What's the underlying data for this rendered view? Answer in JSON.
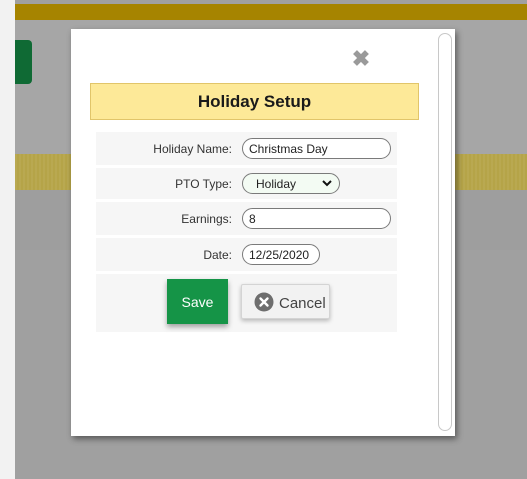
{
  "dialog": {
    "title": "Holiday Setup",
    "close_glyph": "✖",
    "fields": {
      "holiday_name": {
        "label": "Holiday Name:",
        "value": "Christmas Day"
      },
      "pto_type": {
        "label": "PTO Type:",
        "selected": "Holiday"
      },
      "earnings": {
        "label": "Earnings:",
        "value": "8"
      },
      "date": {
        "label": "Date:",
        "value": "12/25/2020"
      }
    },
    "buttons": {
      "save": "Save",
      "cancel": "Cancel"
    }
  },
  "colors": {
    "title_bg": "#fde998",
    "save_bg": "#159447",
    "top_bar": "#a68400"
  },
  "icons": {
    "close": "close-icon",
    "cancel": "x-circle-icon",
    "dropdown": "chevron-down-icon"
  }
}
